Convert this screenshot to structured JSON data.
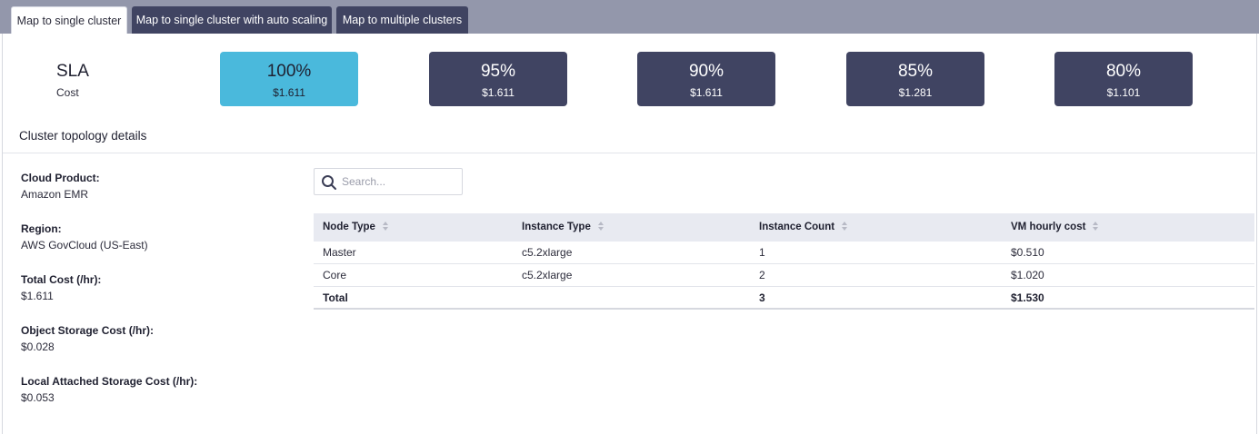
{
  "tabs": [
    {
      "label": "Map to single cluster",
      "active": true
    },
    {
      "label": "Map to single cluster with auto scaling",
      "active": false
    },
    {
      "label": "Map to multiple clusters",
      "active": false
    }
  ],
  "sla": {
    "title": "SLA",
    "cost_label": "Cost",
    "options": [
      {
        "percent": "100%",
        "cost": "$1.611",
        "selected": true
      },
      {
        "percent": "95%",
        "cost": "$1.611",
        "selected": false
      },
      {
        "percent": "90%",
        "cost": "$1.611",
        "selected": false
      },
      {
        "percent": "85%",
        "cost": "$1.281",
        "selected": false
      },
      {
        "percent": "80%",
        "cost": "$1.101",
        "selected": false
      }
    ]
  },
  "section_title": "Cluster topology details",
  "details": [
    {
      "label": "Cloud Product:",
      "value": "Amazon EMR"
    },
    {
      "label": "Region:",
      "value": "AWS GovCloud (US-East)"
    },
    {
      "label": "Total Cost (/hr):",
      "value": "$1.611"
    },
    {
      "label": "Object Storage Cost (/hr):",
      "value": "$0.028"
    },
    {
      "label": "Local Attached Storage Cost (/hr):",
      "value": "$0.053"
    }
  ],
  "search": {
    "placeholder": "Search...",
    "value": "",
    "icon": "search-icon"
  },
  "table": {
    "columns": [
      "Node Type",
      "Instance Type",
      "Instance Count",
      "VM hourly cost"
    ],
    "rows": [
      [
        "Master",
        "c5.2xlarge",
        "1",
        "$0.510"
      ],
      [
        "Core",
        "c5.2xlarge",
        "2",
        "$1.020"
      ]
    ],
    "total": [
      "Total",
      "",
      "3",
      "$1.530"
    ]
  },
  "colors": {
    "tabbar": "#9397ab",
    "inactive_tab": "#404462",
    "sla_card": "#404462",
    "sla_card_selected": "#4ab9dc",
    "table_header": "#e8eaf1"
  }
}
